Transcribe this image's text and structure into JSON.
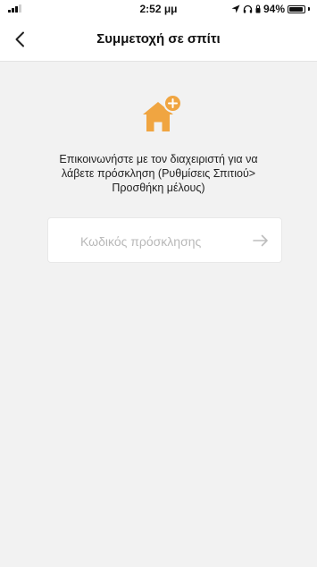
{
  "status_bar": {
    "time": "2:52 μμ",
    "battery": "94%",
    "battery_level": 0.94
  },
  "header": {
    "title": "Συμμετοχή σε σπίτι",
    "back_icon": "chevron-left-icon"
  },
  "main": {
    "icon": "house-add-icon",
    "message_line1": "Επικοινωνήστε με τον διαχειριστή για να",
    "message_line2": "λάβετε πρόσκληση (Ρυθμίσεις Σπιτιού>",
    "message_line3": "Προσθήκη μέλους)",
    "invite_input": {
      "value": "",
      "placeholder": "Κωδικός πρόσκλησης"
    },
    "submit_icon": "arrow-right-icon"
  },
  "colors": {
    "accent": "#f0a541",
    "background": "#f2f2f2",
    "header_bg": "#ffffff"
  }
}
